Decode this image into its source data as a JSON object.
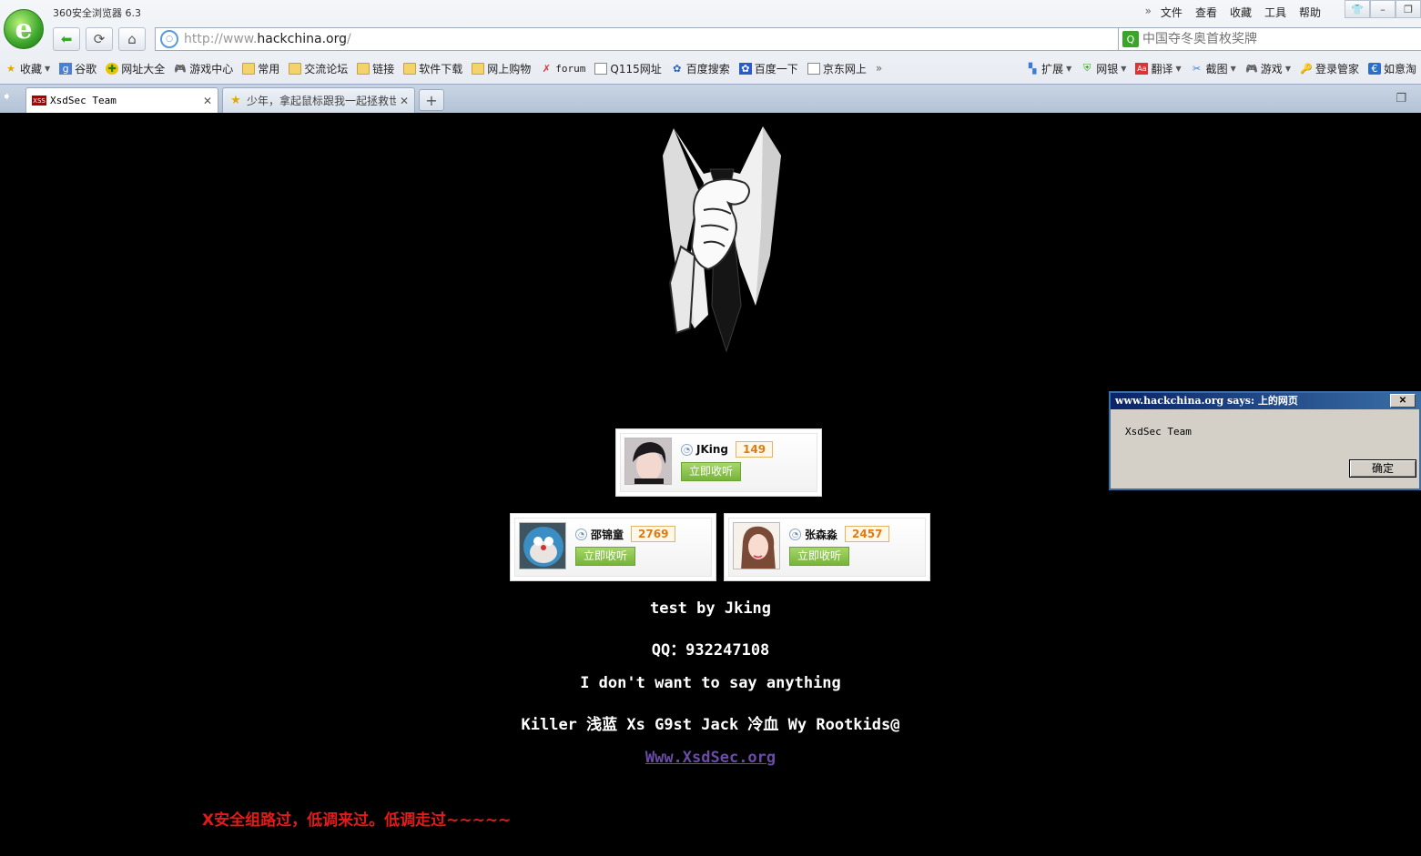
{
  "browser": {
    "title": "360安全浏览器 6.3",
    "menu": [
      "文件",
      "查看",
      "收藏",
      "工具",
      "帮助"
    ],
    "menu_more_icon": "double-chevron-right-icon",
    "window_controls": [
      "shirt-skin-icon",
      "minimize-icon",
      "restore-icon"
    ],
    "nav_icons": [
      "back-arrow-icon",
      "refresh-icon",
      "home-icon"
    ],
    "url": {
      "prefix": "http://www.",
      "domain": "hackchina.org",
      "suffix": "/"
    },
    "search": {
      "placeholder": "中国夺冬奥首枚奖牌"
    },
    "bookmarks": [
      {
        "label": "收藏",
        "icon": "star-icon"
      },
      {
        "label": "谷歌",
        "icon": "google-icon"
      },
      {
        "label": "网址大全",
        "icon": "globe-icon"
      },
      {
        "label": "游戏中心",
        "icon": "gamepad-icon"
      },
      {
        "label": "常用",
        "icon": "folder-icon"
      },
      {
        "label": "交流论坛",
        "icon": "folder-icon"
      },
      {
        "label": "链接",
        "icon": "folder-icon"
      },
      {
        "label": "软件下载",
        "icon": "folder-icon"
      },
      {
        "label": "网上购物",
        "icon": "folder-icon"
      },
      {
        "label": "forum",
        "icon": "x-logo-icon"
      },
      {
        "label": "Q115网址",
        "icon": "document-icon"
      },
      {
        "label": "百度搜索",
        "icon": "baidu-paw-icon"
      },
      {
        "label": "百度一下",
        "icon": "baidu-icon"
      },
      {
        "label": "京东网上",
        "icon": "document-icon"
      }
    ],
    "toolbar_right": [
      {
        "label": "扩展",
        "icon": "extensions-icon"
      },
      {
        "label": "网银",
        "icon": "shield-icon"
      },
      {
        "label": "翻译",
        "icon": "translate-icon"
      },
      {
        "label": "截图",
        "icon": "screenshot-icon"
      },
      {
        "label": "游戏",
        "icon": "gamepad-icon"
      },
      {
        "label": "登录管家",
        "icon": "key-icon"
      },
      {
        "label": "如意淘",
        "icon": "shopping-icon"
      }
    ],
    "tabs": [
      {
        "label": "XsdSec Team",
        "active": true
      },
      {
        "label": "少年，拿起鼠标跟我一起拯救世",
        "active": false
      }
    ],
    "new_tab_label": "+"
  },
  "page": {
    "users": [
      {
        "name": "JKing",
        "count": "149",
        "follow_label": "立即收听"
      },
      {
        "name": "邵锦童",
        "count": "2769",
        "follow_label": "立即收听"
      },
      {
        "name": "张森淼",
        "count": "2457",
        "follow_label": "立即收听"
      }
    ],
    "lines": [
      "test by Jking",
      "QQ：932247108",
      "I don't want to say anything",
      "Killer 浅蓝 Xs G9st Jack 冷血 Wy Rootkids@"
    ],
    "link_text": "Www.XsdSec.org",
    "footer_text": "X安全组路过，低调来过。低调走过~~~~~",
    "colors": {
      "footer": "#e41a1a",
      "link": "#6b4ba8",
      "badge": "#e07a12",
      "follow": "#77b43a"
    }
  },
  "alert": {
    "title": "www.hackchina.org says: 上的网页",
    "message": "XsdSec Team",
    "ok_label": "确定",
    "close_label": "✕"
  }
}
